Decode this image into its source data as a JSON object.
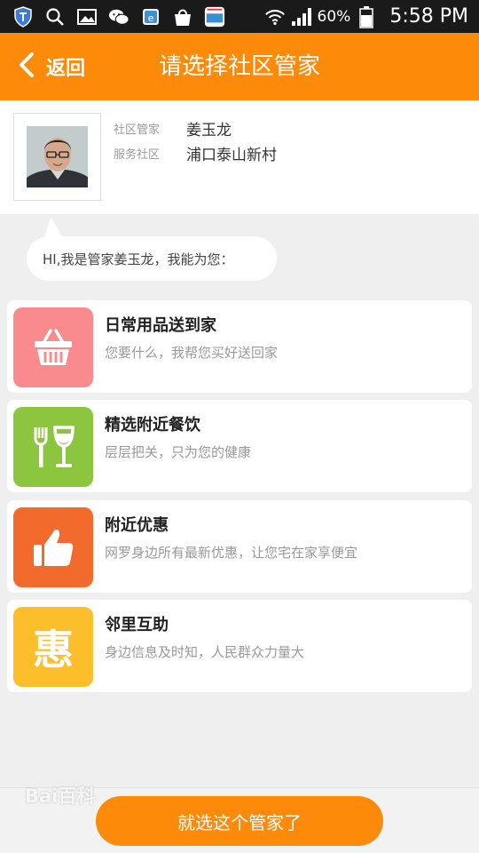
{
  "status_bar": {
    "icons": [
      "shield-icon",
      "search-icon",
      "gallery-icon",
      "wechat-icon",
      "browser-icon",
      "shopping-bag-icon",
      "app-store-icon",
      "wifi-icon",
      "signal-icon",
      "battery-icon"
    ],
    "battery": "60%",
    "time": "5:58 PM"
  },
  "header": {
    "back_label": "返回",
    "title": "请选择社区管家",
    "bg_color": "#fe8a0a"
  },
  "profile": {
    "manager_label": "社区管家",
    "manager_name": "姜玉龙",
    "community_label": "服务社区",
    "community_name": "浦口泰山新村"
  },
  "greeting": "HI,我是管家姜玉龙，我能为您：",
  "services": [
    {
      "title": "日常用品送到家",
      "desc": "您要什么，我帮您买好送回家",
      "icon": "basket-icon",
      "color": "#f98b8e"
    },
    {
      "title": "精选附近餐饮",
      "desc": "层层把关，只为您的健康",
      "icon": "fork-wineglass-icon",
      "color": "#8cc53e"
    },
    {
      "title": "附近优惠",
      "desc": "网罗身边所有最新优惠，让您宅在家享便宜",
      "icon": "thumbs-up-icon",
      "color": "#f26a2c"
    },
    {
      "title": "邻里互助",
      "desc": "身边信息及时知，人民群众力量大",
      "icon": "hui-icon",
      "icon_text": "惠",
      "color": "#fdbe2c"
    }
  ],
  "watermark": "Bai百科",
  "confirm_button": "就选这个管家了"
}
